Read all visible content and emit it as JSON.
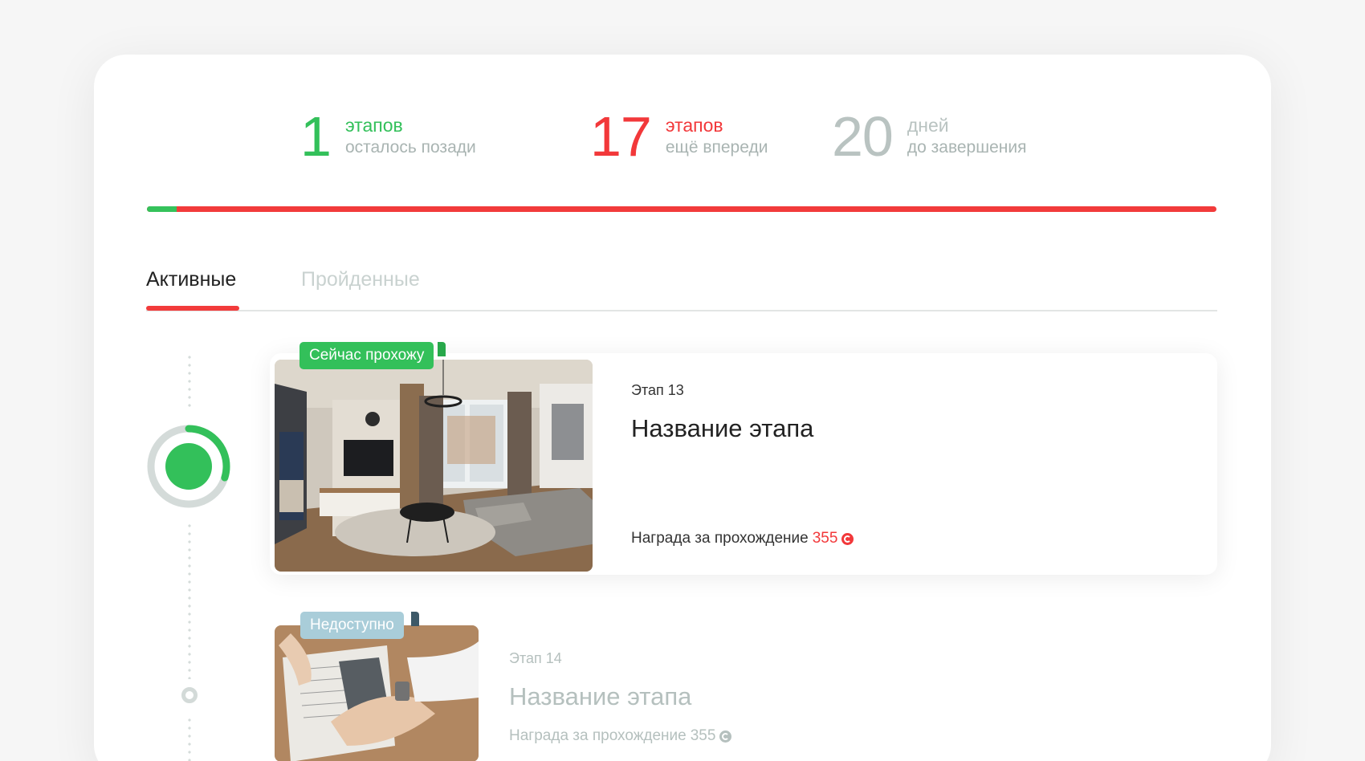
{
  "stats": [
    {
      "number": "1",
      "top": "этапов",
      "bottom": "осталось позади"
    },
    {
      "number": "17",
      "top": "этапов",
      "bottom": "ещё впереди"
    },
    {
      "number": "20",
      "top": "дней",
      "bottom": "до завершения"
    }
  ],
  "progress": {
    "completed_fraction": 0.028
  },
  "tabs": [
    {
      "label": "Активные",
      "active": true
    },
    {
      "label": "Пройденные",
      "active": false
    }
  ],
  "stages": [
    {
      "badge": "Сейчас прохожу",
      "stage": "Этап 13",
      "title": "Название этапа",
      "reward_label": "Награда за прохождение",
      "reward_value": "355",
      "image_icon": "living-room-photo",
      "status": "current"
    },
    {
      "badge": "Недоступно",
      "stage": "Этап 14",
      "title": "Название этапа",
      "reward_label": "Награда за прохождение",
      "reward_value": "355",
      "image_icon": "hands-writing-photo",
      "status": "locked"
    }
  ],
  "colors": {
    "green": "#33c05a",
    "red": "#f2383a",
    "grey": "#b9c3c1",
    "locked_badge": "#a9cdd9"
  }
}
